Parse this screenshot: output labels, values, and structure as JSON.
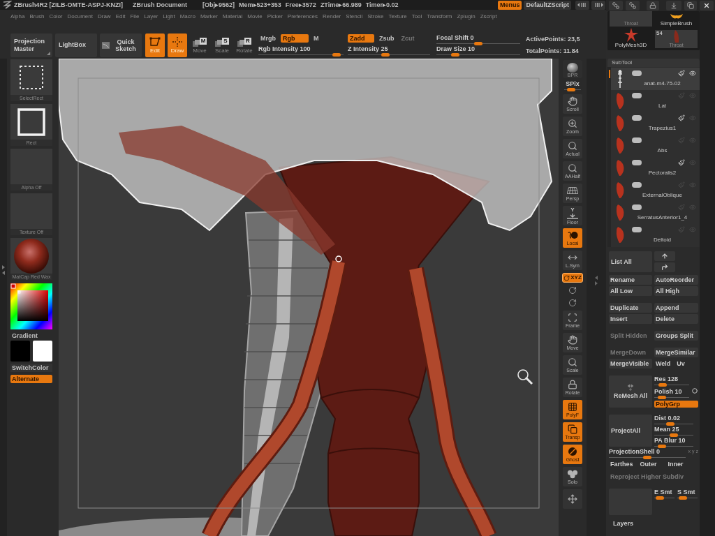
{
  "title_bar": {
    "app_title": "ZBrush4R2 [ZILB-OMTE-ASPJ-KNZI]",
    "document": "ZBrush Document",
    "stats": [
      "[Obj▸9562]",
      "Mem▸523+353",
      "Free▸3572",
      "ZTime▸66.989",
      "Timer▸0.02"
    ],
    "buttons": [
      {
        "label": "Menus",
        "selected": true
      },
      {
        "label": "DefaultZScript",
        "selected": false
      }
    ]
  },
  "menu_bar": [
    "Alpha",
    "Brush",
    "Color",
    "Document",
    "Draw",
    "Edit",
    "File",
    "Layer",
    "Light",
    "Macro",
    "Marker",
    "Material",
    "Movie",
    "Picker",
    "Preferences",
    "Render",
    "Stencil",
    "Stroke",
    "Texture",
    "Tool",
    "Transform",
    "Zplugin",
    "Zscript"
  ],
  "toolbar": {
    "panel_buttons": [
      "Projection Master",
      "LightBox"
    ],
    "quick_sketch": "Quick Sketch",
    "modes": [
      {
        "kind": "edit",
        "label": "Edit",
        "selected": true
      },
      {
        "kind": "draw",
        "label": "Draw",
        "selected": true
      },
      {
        "kind": "transform",
        "label": "Move",
        "key": "M",
        "selected": false
      },
      {
        "kind": "transform",
        "label": "Scale",
        "key": "S",
        "selected": false
      },
      {
        "kind": "transform",
        "label": "Rotate",
        "key": "R",
        "selected": false
      }
    ],
    "color_modes": [
      {
        "label": "Mrgb",
        "selected": false
      },
      {
        "label": "Rgb",
        "selected": true
      },
      {
        "label": "M",
        "selected": false
      }
    ],
    "rgb_intensity": {
      "label": "Rgb Intensity",
      "value": "100",
      "level": 0.96
    },
    "depth_modes": [
      {
        "label": "Zadd",
        "selected": true,
        "disabled": false
      },
      {
        "label": "Zsub",
        "selected": false,
        "disabled": false
      },
      {
        "label": "Zcut",
        "selected": false,
        "disabled": true
      }
    ],
    "z_intensity": {
      "label": "Z Intensity",
      "value": "25",
      "level": 0.45
    },
    "focal_shift": {
      "label": "Focal Shift",
      "value": "0",
      "level": 0.5
    },
    "draw_size": {
      "label": "Draw Size",
      "value": "10",
      "level": 0.19
    },
    "stats": [
      "ActivePoints: 23,5",
      "TotalPoints: 11.84"
    ]
  },
  "left_shelf": {
    "items": [
      {
        "kind": "select_rect",
        "label": "SelectRect"
      },
      {
        "kind": "rect",
        "label": "Rect"
      },
      {
        "kind": "empty",
        "label": "Alpha Off"
      },
      {
        "kind": "empty",
        "label": "Texture Off"
      },
      {
        "kind": "material",
        "label": "MatCap Red Wax"
      }
    ],
    "gradient": "Gradient",
    "swatches": [
      {
        "color": "#000000"
      },
      {
        "color": "#ffffff"
      }
    ],
    "switch_color": "SwitchColor",
    "alternate": {
      "label": "Alternate",
      "selected": true
    }
  },
  "right_toolbar": [
    {
      "kind": "bpr",
      "label": "BPR",
      "selected": false
    },
    {
      "kind": "slider",
      "label": "SPix",
      "level": 0.35
    },
    {
      "kind": "button",
      "label": "Scroll",
      "selected": false
    },
    {
      "kind": "button",
      "label": "Zoom",
      "selected": false
    },
    {
      "kind": "button",
      "label": "Actual",
      "selected": false
    },
    {
      "kind": "button",
      "label": "AAHalf",
      "selected": false
    },
    {
      "kind": "button",
      "label": "Persp",
      "selected": false
    },
    {
      "kind": "button",
      "label": "Floor",
      "axis": "Y",
      "selected": false
    },
    {
      "kind": "button",
      "label": "Local",
      "selected": true
    },
    {
      "kind": "button",
      "label": "L.Sym",
      "selected": false
    },
    {
      "kind": "small",
      "label": "XYZ",
      "selected": true
    },
    {
      "kind": "icon",
      "selected": false
    },
    {
      "kind": "icon",
      "selected": false
    },
    {
      "kind": "button",
      "label": "Frame",
      "selected": false
    },
    {
      "kind": "button",
      "label": "Move",
      "selected": false
    },
    {
      "kind": "button",
      "label": "Scale",
      "selected": false
    },
    {
      "kind": "button",
      "label": "Rotate",
      "selected": false
    },
    {
      "kind": "button",
      "label": "PolyF",
      "selected": true
    },
    {
      "kind": "button",
      "label": "Transp",
      "selected": true
    },
    {
      "kind": "button",
      "label": "Ghost",
      "selected": true
    },
    {
      "kind": "button",
      "label": "Solo",
      "selected": false
    },
    {
      "kind": "button",
      "selected": false
    }
  ],
  "tool_thumbnails": [
    {
      "label": "Throat"
    },
    {
      "label": "SimpleBrush"
    },
    {
      "label": "PolyMesh3D"
    },
    {
      "label": "Throat",
      "count": "54"
    }
  ],
  "subtool": {
    "title": "SubTool",
    "items": [
      {
        "kind": "skeleton",
        "name": "anat-m4-75-02",
        "selected": true,
        "visible": true,
        "colorize": true
      },
      {
        "kind": "muscle",
        "name": "Lat",
        "selected": false,
        "visible": false,
        "colorize": false
      },
      {
        "kind": "muscle",
        "name": "Trapezius1",
        "selected": false,
        "visible": false,
        "colorize": true
      },
      {
        "kind": "muscle",
        "name": "Abs",
        "selected": false,
        "visible": false,
        "colorize": false
      },
      {
        "kind": "muscle",
        "name": "Pectoralis2",
        "selected": false,
        "visible": false,
        "colorize": true
      },
      {
        "kind": "muscle",
        "name": "ExternalOblique",
        "selected": false,
        "visible": false,
        "colorize": false
      },
      {
        "kind": "muscle",
        "name": "SerratusAnterior1_4",
        "selected": false,
        "visible": false,
        "colorize": false
      },
      {
        "kind": "muscle",
        "name": "Deltoid",
        "selected": false,
        "visible": false,
        "colorize": false
      }
    ],
    "list_all": "List All",
    "button_groups": [
      [
        [
          {
            "kind": "button",
            "label": "Rename",
            "disabled": false
          },
          {
            "kind": "button",
            "label": "AutoReorder",
            "disabled": false
          }
        ],
        [
          {
            "kind": "button",
            "label": "All Low",
            "disabled": false
          },
          {
            "kind": "button",
            "label": "All High",
            "disabled": false
          }
        ]
      ],
      [
        [
          {
            "kind": "button",
            "label": "Duplicate",
            "disabled": false
          },
          {
            "kind": "button",
            "label": "Append",
            "disabled": false
          }
        ],
        [
          {
            "kind": "button",
            "label": "Insert",
            "disabled": false
          },
          {
            "kind": "button",
            "label": "Delete",
            "disabled": false
          }
        ]
      ],
      [
        [
          {
            "kind": "button",
            "label": "Split Hidden",
            "disabled": true
          },
          {
            "kind": "button",
            "label": "Groups Split",
            "disabled": false
          }
        ]
      ],
      [
        [
          {
            "kind": "button",
            "label": "MergeDown",
            "disabled": true
          },
          {
            "kind": "button",
            "label": "MergeSimilar",
            "disabled": false
          }
        ],
        [
          {
            "kind": "button",
            "label": "MergeVisible",
            "disabled": false
          },
          {
            "kind": "toggle",
            "label": "Weld",
            "disabled": false
          },
          {
            "kind": "toggle",
            "label": "Uv",
            "disabled": false
          }
        ]
      ]
    ],
    "remesh": {
      "button": "ReMesh All",
      "sliders": [
        {
          "label": "Res",
          "value": "128",
          "level": 0.15
        },
        {
          "label": "Polish",
          "value": "10",
          "level": 0.12
        }
      ],
      "polygroup": {
        "label": "PolyGrp",
        "selected": true
      }
    },
    "project": {
      "button": "ProjectAll",
      "sliders": [
        {
          "label": "Dist",
          "value": "0.02",
          "level": 0.38
        },
        {
          "label": "Mean",
          "value": "25",
          "level": 0.5
        },
        {
          "label": "PA Blur",
          "value": "10",
          "level": 0.12
        }
      ]
    },
    "projection_shell": {
      "label": "ProjectionShell",
      "value": "0",
      "level": 0.5,
      "axes": "x y z"
    },
    "projection_modes": [
      "Farthes",
      "Outer",
      "Inner"
    ],
    "reproject": {
      "label": "Reproject Higher Subdiv",
      "disabled": true
    },
    "smoothing": [
      {
        "label": "E Smt",
        "level": 0.1
      },
      {
        "label": "S Smt",
        "level": 0.1
      }
    ]
  },
  "layers": {
    "title": "Layers"
  }
}
